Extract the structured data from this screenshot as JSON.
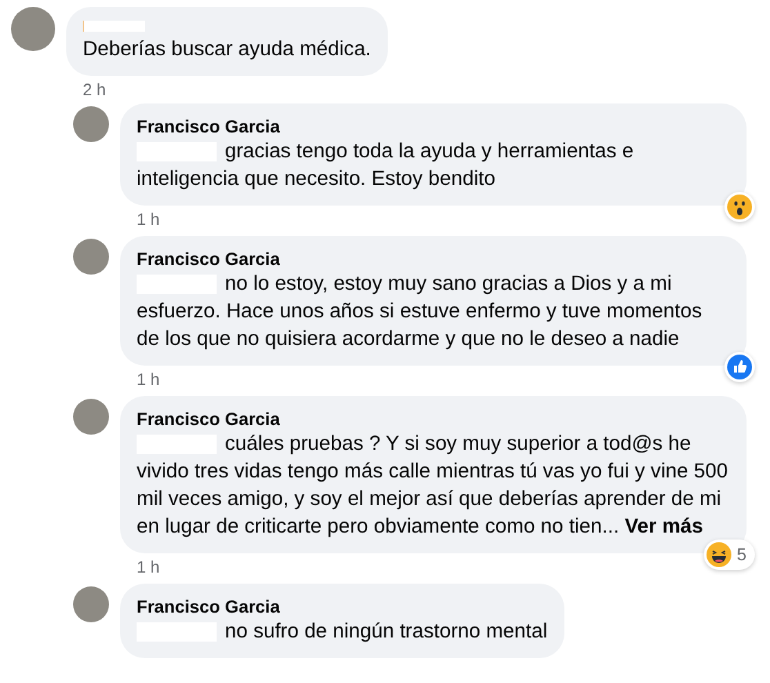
{
  "comments": [
    {
      "author_redacted": true,
      "text": "Deberías buscar ayuda médica.",
      "time": "2 h",
      "replies": [
        {
          "author": "Francisco Garcia",
          "mention_redacted": true,
          "text": "gracias tengo toda la ayuda y herramientas e inteligencia que necesito. Estoy bendito",
          "time": "1 h",
          "reaction": {
            "kind": "wow"
          }
        },
        {
          "author": "Francisco Garcia",
          "mention_redacted": true,
          "text": "no lo estoy, estoy muy sano gracias a Dios y a mi esfuerzo. Hace unos años si estuve enfermo y tuve momentos de los que no quisiera acordarme y que no le deseo a nadie",
          "time": "1 h",
          "reaction": {
            "kind": "like"
          }
        },
        {
          "author": "Francisco Garcia",
          "mention_redacted": true,
          "text": "cuáles pruebas ? Y si soy muy superior a tod@s he vivido tres vidas tengo más calle mientras tú vas yo fui y vine 500 mil veces amigo, y soy el mejor así que deberías aprender de mi en lugar de criticarte pero obviamente como no tien...",
          "more": "Ver más",
          "time": "1 h",
          "reaction": {
            "kind": "haha",
            "count": "5"
          }
        },
        {
          "author": "Francisco Garcia",
          "mention_redacted": true,
          "text": "no sufro de ningún trastorno mental"
        }
      ]
    }
  ]
}
